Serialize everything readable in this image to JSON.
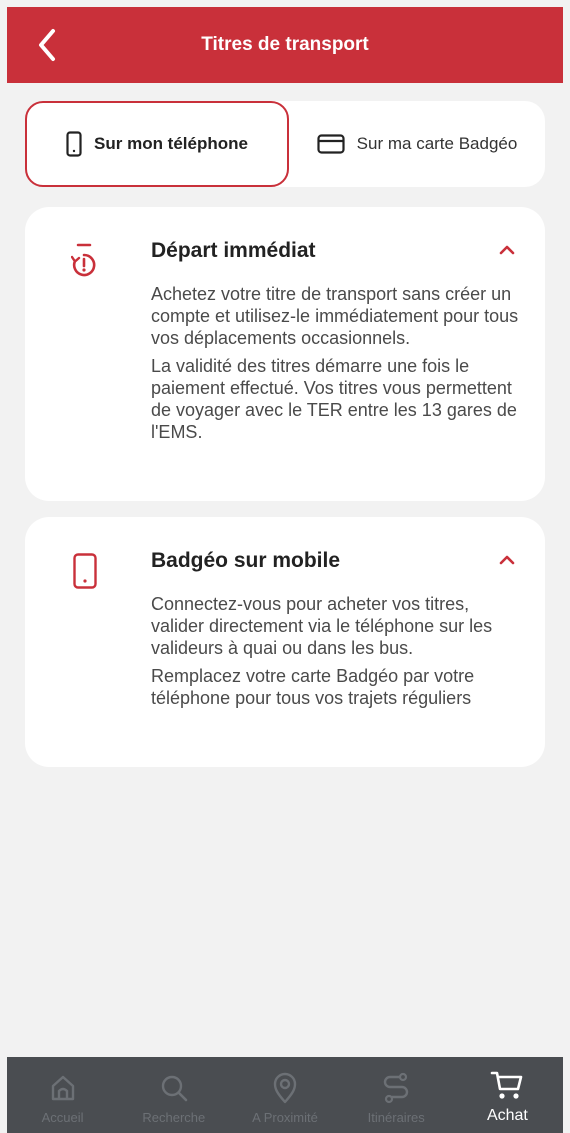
{
  "header": {
    "title": "Titres de transport"
  },
  "segment": {
    "phone_label": "Sur mon téléphone",
    "card_label": "Sur ma carte Badgéo"
  },
  "cards": [
    {
      "title": "Départ immédiat",
      "icon": "timer-icon",
      "paragraphs": [
        "Achetez votre titre de transport sans créer un compte et utilisez-le immédiatement pour tous vos déplacements occasionnels.",
        "La validité des titres démarre une fois le paiement effectué. Vos titres vous permettent de voyager avec le TER entre les 13 gares de l'EMS."
      ]
    },
    {
      "title": "Badgéo sur mobile",
      "icon": "mobile-icon",
      "paragraphs": [
        "Connectez-vous pour acheter vos titres, valider directement via le téléphone sur les valideurs à quai ou dans les bus.",
        "Remplacez votre carte Badgéo par votre téléphone pour tous vos trajets réguliers"
      ]
    }
  ],
  "tabs": [
    {
      "label": "Accueil",
      "icon": "home-icon"
    },
    {
      "label": "Recherche",
      "icon": "search-icon"
    },
    {
      "label": "A Proximité",
      "icon": "location-pin-icon"
    },
    {
      "label": "Itinéraires",
      "icon": "route-icon"
    },
    {
      "label": "Achat",
      "icon": "cart-icon",
      "active": true
    }
  ],
  "colors": {
    "accent": "#c9303a",
    "tabbar": "#4a4d51",
    "background": "#f2f2f2"
  }
}
